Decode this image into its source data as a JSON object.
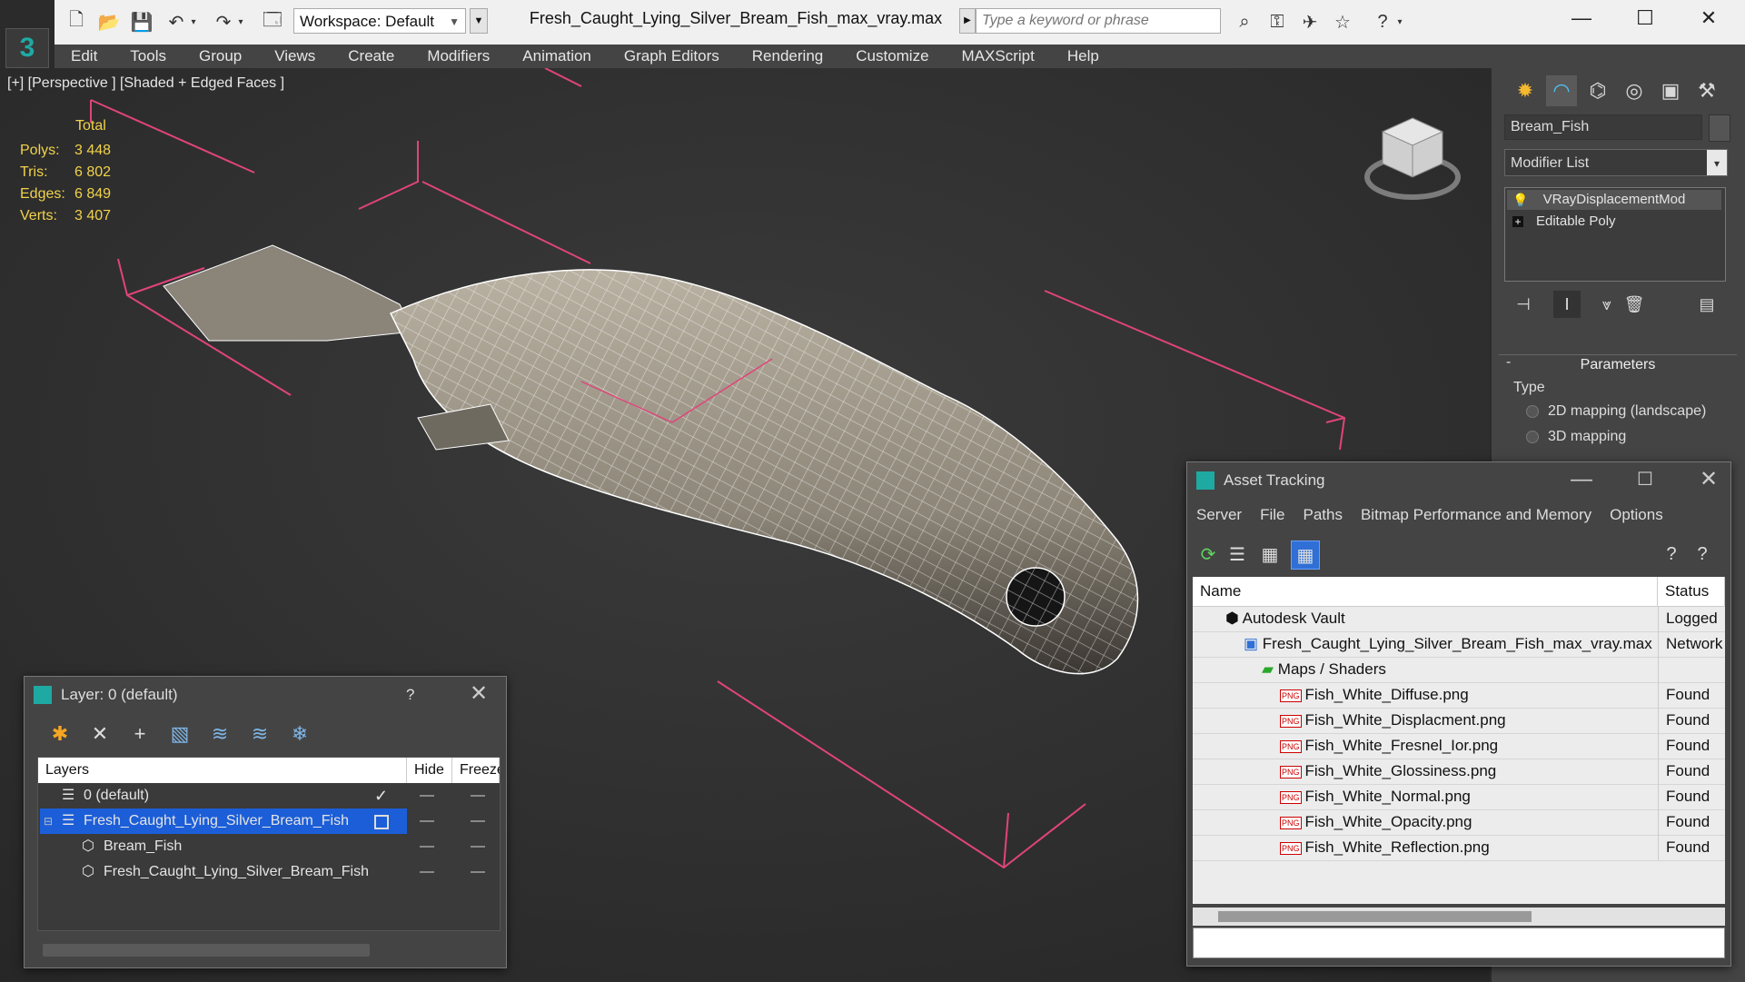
{
  "titlebar": {
    "workspace_label": "Workspace: Default",
    "file_title": "Fresh_Caught_Lying_Silver_Bream_Fish_max_vray.max",
    "search_placeholder": "Type a keyword or phrase"
  },
  "menu": [
    "Edit",
    "Tools",
    "Group",
    "Views",
    "Create",
    "Modifiers",
    "Animation",
    "Graph Editors",
    "Rendering",
    "Customize",
    "MAXScript",
    "Help"
  ],
  "viewport": {
    "label": "[+] [Perspective ] [Shaded + Edged Faces ]",
    "stats_total_label": "Total",
    "stats": [
      {
        "label": "Polys:",
        "value": "3 448"
      },
      {
        "label": "Tris:",
        "value": "6 802"
      },
      {
        "label": "Edges:",
        "value": "6 849"
      },
      {
        "label": "Verts:",
        "value": "3 407"
      }
    ],
    "stats_color": "#f2d24a"
  },
  "command_panel": {
    "object_name": "Bream_Fish",
    "modifier_list_label": "Modifier List",
    "stack": [
      "VRayDisplacementMod",
      "Editable Poly"
    ],
    "rollout_title": "Parameters",
    "rollout_toggle": "-",
    "type_label": "Type",
    "radio_options": [
      "2D mapping (landscape)",
      "3D mapping"
    ]
  },
  "layer_window": {
    "title": "Layer: 0 (default)",
    "help": "?",
    "columns": [
      "Layers",
      "Hide",
      "Freeze"
    ],
    "rows": [
      {
        "name": "0 (default)",
        "active_mark": "✓"
      },
      {
        "name": "Fresh_Caught_Lying_Silver_Bream_Fish",
        "selected": true
      },
      {
        "name": "Bream_Fish"
      },
      {
        "name": "Fresh_Caught_Lying_Silver_Bream_Fish"
      }
    ],
    "selection_color": "#1c5ed8"
  },
  "asset_window": {
    "title": "Asset Tracking",
    "menu": [
      "Server",
      "File",
      "Paths",
      "Bitmap Performance and Memory",
      "Options"
    ],
    "columns": [
      "Name",
      "Status"
    ],
    "rows": [
      {
        "name": "Autodesk Vault",
        "status": "Logged"
      },
      {
        "name": "Fresh_Caught_Lying_Silver_Bream_Fish_max_vray.max",
        "status": "Network"
      },
      {
        "name": "Maps / Shaders",
        "status": ""
      },
      {
        "name": "Fish_White_Diffuse.png",
        "status": "Found"
      },
      {
        "name": "Fish_White_Displacment.png",
        "status": "Found"
      },
      {
        "name": "Fish_White_Fresnel_Ior.png",
        "status": "Found"
      },
      {
        "name": "Fish_White_Glossiness.png",
        "status": "Found"
      },
      {
        "name": "Fish_White_Normal.png",
        "status": "Found"
      },
      {
        "name": "Fish_White_Opacity.png",
        "status": "Found"
      },
      {
        "name": "Fish_White_Reflection.png",
        "status": "Found"
      }
    ],
    "file_icon_label": "PNG"
  },
  "icons": {
    "accent": "#1fa9a3",
    "wire_color": "#e0447a"
  }
}
